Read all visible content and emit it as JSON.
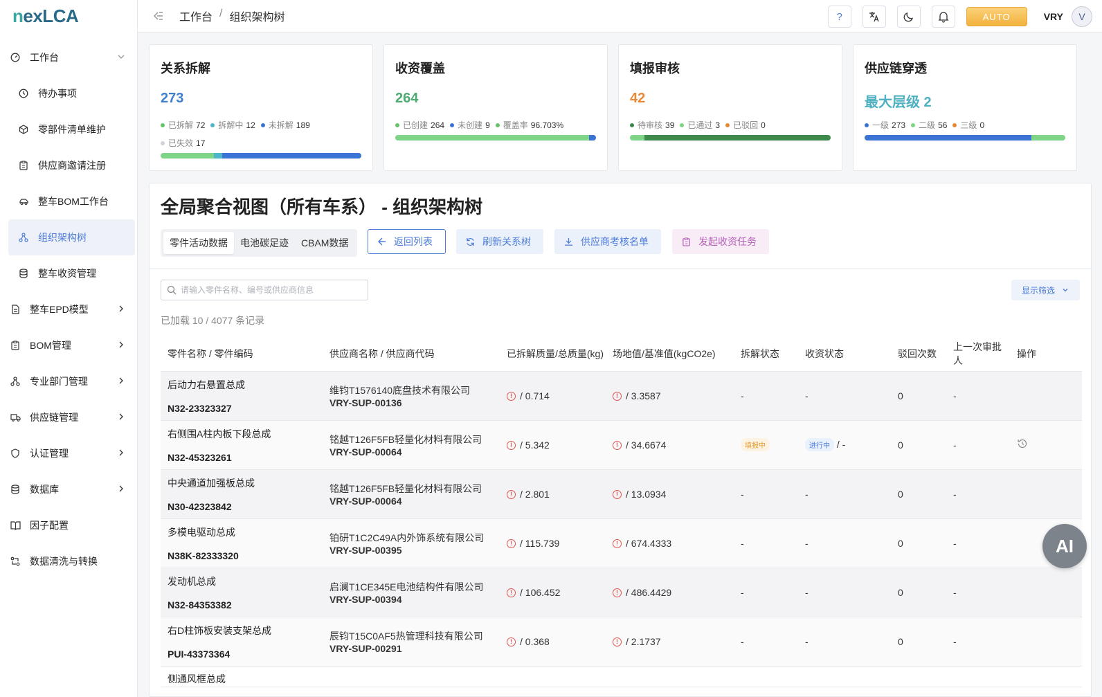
{
  "app": {
    "logo": "nexLCA",
    "user": "VRY",
    "avatar_initial": "V",
    "auto_label": "AUTO",
    "help_label": "?"
  },
  "breadcrumb": {
    "items": [
      "工作台",
      "组织架构树"
    ],
    "sep": "/"
  },
  "sidebar": {
    "items": [
      {
        "label": "工作台",
        "icon": "dashboard-icon",
        "chevron": "down"
      },
      {
        "label": "待办事项",
        "icon": "clock-icon"
      },
      {
        "label": "零部件清单维护",
        "icon": "box-icon"
      },
      {
        "label": "供应商邀请注册",
        "icon": "clipboard-icon"
      },
      {
        "label": "整车BOM工作台",
        "icon": "car-icon"
      },
      {
        "label": "组织架构树",
        "icon": "org-tree-icon",
        "active": true
      },
      {
        "label": "整车收资管理",
        "icon": "database-icon"
      },
      {
        "label": "整车EPD模型",
        "icon": "document-icon",
        "chevron": "right"
      },
      {
        "label": "BOM管理",
        "icon": "clipboard-icon",
        "chevron": "right"
      },
      {
        "label": "专业部门管理",
        "icon": "org-tree-icon",
        "chevron": "right"
      },
      {
        "label": "供应链管理",
        "icon": "truck-icon",
        "chevron": "right"
      },
      {
        "label": "认证管理",
        "icon": "shield-icon",
        "chevron": "right"
      },
      {
        "label": "数据库",
        "icon": "database-icon",
        "chevron": "right"
      },
      {
        "label": "因子配置",
        "icon": "book-icon"
      },
      {
        "label": "数据清洗与转换",
        "icon": "transform-icon"
      }
    ]
  },
  "cards": [
    {
      "title": "关系拆解",
      "value": "273",
      "value_color": "#3f7ecf",
      "legend": [
        {
          "label": "已拆解",
          "value": "72",
          "color": "#67c46b"
        },
        {
          "label": "拆解中",
          "value": "12",
          "color": "#4fb6c9"
        },
        {
          "label": "未拆解",
          "value": "189",
          "color": "#3b74d4"
        },
        {
          "label": "已失效",
          "value": "17",
          "color": "#cfd2d8"
        }
      ],
      "bar": [
        {
          "frac": 0.264,
          "color": "#7ed487"
        },
        {
          "frac": 0.044,
          "color": "#4fb6c9"
        },
        {
          "frac": 0.692,
          "color": "#3b74d4"
        }
      ]
    },
    {
      "title": "收资覆盖",
      "value": "264",
      "value_color": "#4daa73",
      "legend": [
        {
          "label": "已创建",
          "value": "264",
          "color": "#67c46b"
        },
        {
          "label": "未创建",
          "value": "9",
          "color": "#3b74d4"
        },
        {
          "label": "覆盖率",
          "value": "96.703%",
          "color": "#67c46b"
        }
      ],
      "bar": [
        {
          "frac": 0.967,
          "color": "#7ed487"
        },
        {
          "frac": 0.033,
          "color": "#3b74d4"
        }
      ]
    },
    {
      "title": "填报审核",
      "value": "42",
      "value_color": "#e8893a",
      "legend": [
        {
          "label": "待审核",
          "value": "39",
          "color": "#3d8a4c"
        },
        {
          "label": "已通过",
          "value": "3",
          "color": "#7ed487"
        },
        {
          "label": "已驳回",
          "value": "0",
          "color": "#e8893a"
        }
      ],
      "bar": [
        {
          "frac": 0.071,
          "color": "#7ed487"
        },
        {
          "frac": 0.929,
          "color": "#3d8a4c"
        }
      ]
    },
    {
      "title": "供应链穿透",
      "value": "最大层级 2",
      "value_color": "#4fb0c0",
      "legend": [
        {
          "label": "一级",
          "value": "273",
          "color": "#3b74d4"
        },
        {
          "label": "二级",
          "value": "56",
          "color": "#7ed487"
        },
        {
          "label": "三级",
          "value": "0",
          "color": "#e8893a"
        }
      ],
      "bar": [
        {
          "frac": 0.83,
          "color": "#3b74d4"
        },
        {
          "frac": 0.17,
          "color": "#7ed487"
        }
      ]
    }
  ],
  "panel": {
    "title": "全局聚合视图（所有车系） - 组织架构树",
    "tabs": [
      {
        "label": "零件活动数据",
        "active": true
      },
      {
        "label": "电池碳足迹"
      },
      {
        "label": "CBAM数据"
      }
    ],
    "actions": {
      "back": "返回列表",
      "refresh": "刷新关系树",
      "supplier_list": "供应商考核名单",
      "collect": "发起收资任务"
    },
    "search_placeholder": "请输入零件名称、编号或供应商信息",
    "filter_label": "显示筛选",
    "loaded_text": "已加载 10 / 4077 条记录"
  },
  "table": {
    "headers": [
      "零件名称 / 零件编码",
      "供应商名称 / 供应商代码",
      "已拆解质量/总质量(kg)",
      "场地值/基准值(kgCO2e)",
      "拆解状态",
      "收资状态",
      "驳回次数",
      "上一次审批人",
      "操作"
    ],
    "rows": [
      {
        "name": "后动力右悬置总成",
        "code": "N32-23323327",
        "supplier": "维钧T1576140底盘技术有限公司",
        "scode": "VRY-SUP-00136",
        "mass": "/ 0.714",
        "site": "/ 3.3587",
        "split": "-",
        "collect": "-",
        "rejects": "0",
        "approver": "-"
      },
      {
        "name": "右侧围A柱内板下段总成",
        "code": "N32-45323261",
        "supplier": "铭越T126F5FB轻量化材料有限公司",
        "scode": "VRY-SUP-00064",
        "mass": "/ 5.342",
        "site": "/ 34.6674",
        "split": "填报中",
        "collect": "进行中",
        "collect_suffix": "/ -",
        "rejects": "0",
        "approver": "-",
        "has_history": true
      },
      {
        "name": "中央通道加强板总成",
        "code": "N30-42323842",
        "supplier": "铭越T126F5FB轻量化材料有限公司",
        "scode": "VRY-SUP-00064",
        "mass": "/ 2.801",
        "site": "/ 13.0934",
        "split": "-",
        "collect": "-",
        "rejects": "0",
        "approver": "-"
      },
      {
        "name": "多模电驱动总成",
        "code": "N38K-82333320",
        "supplier": "铂研T1C2C49A内外饰系统有限公司",
        "scode": "VRY-SUP-00395",
        "mass": "/ 115.739",
        "site": "/ 674.4333",
        "split": "-",
        "collect": "-",
        "rejects": "0",
        "approver": "-"
      },
      {
        "name": "发动机总成",
        "code": "N32-84353382",
        "supplier": "启澜T1CE345E电池结构件有限公司",
        "scode": "VRY-SUP-00394",
        "mass": "/ 106.452",
        "site": "/ 486.4429",
        "split": "-",
        "collect": "-",
        "rejects": "0",
        "approver": "-"
      },
      {
        "name": "右D柱饰板安装支架总成",
        "code": "PUI-43373364",
        "supplier": "辰钧T15C0AF5热管理科技有限公司",
        "scode": "VRY-SUP-00291",
        "mass": "/ 0.368",
        "site": "/ 2.1737",
        "split": "-",
        "collect": "-",
        "rejects": "0",
        "approver": "-"
      }
    ],
    "partial_row_name": "侧通风框总成"
  },
  "ai_label": "AI"
}
